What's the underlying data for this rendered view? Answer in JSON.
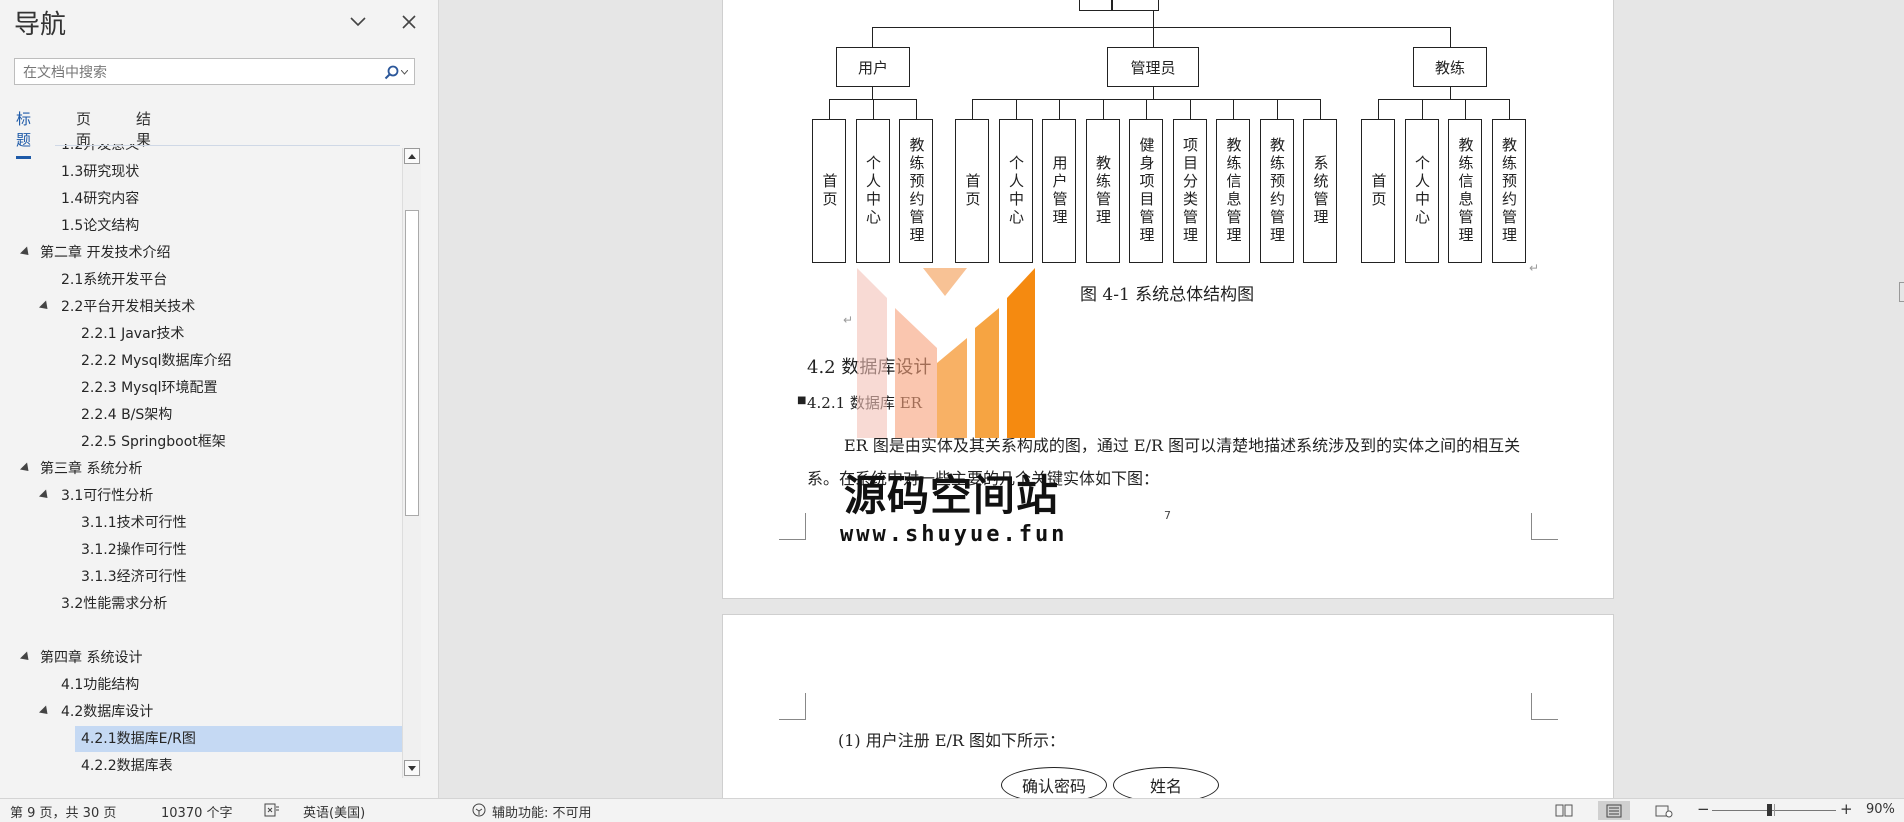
{
  "nav": {
    "title": "导航",
    "search_placeholder": "在文档中搜索",
    "tabs": [
      "标题",
      "页面",
      "结果"
    ],
    "tree": [
      {
        "label": "1.2开发意义",
        "level": 1,
        "expanded": false,
        "partial": true
      },
      {
        "label": "1.3研究现状",
        "level": 1
      },
      {
        "label": "1.4研究内容",
        "level": 1
      },
      {
        "label": "1.5论文结构",
        "level": 1
      },
      {
        "label": "第二章 开发技术介绍",
        "level": 0,
        "expanded": true
      },
      {
        "label": "2.1系统开发平台",
        "level": 1
      },
      {
        "label": "2.2平台开发相关技术",
        "level": 1,
        "expanded": true
      },
      {
        "label": "2.2.1 Javar技术",
        "level": 2
      },
      {
        "label": "2.2.2 Mysql数据库介绍",
        "level": 2
      },
      {
        "label": "2.2.3 Mysql环境配置",
        "level": 2
      },
      {
        "label": "2.2.4 B/S架构",
        "level": 2
      },
      {
        "label": "2.2.5 Springboot框架",
        "level": 2
      },
      {
        "label": "第三章 系统分析",
        "level": 0,
        "expanded": true
      },
      {
        "label": "3.1可行性分析",
        "level": 1,
        "expanded": true
      },
      {
        "label": "3.1.1技术可行性",
        "level": 2
      },
      {
        "label": "3.1.2操作可行性",
        "level": 2
      },
      {
        "label": "3.1.3经济可行性",
        "level": 2
      },
      {
        "label": "3.2性能需求分析",
        "level": 1
      },
      {
        "label": "",
        "level": 1
      },
      {
        "label": "第四章 系统设计",
        "level": 0,
        "expanded": true
      },
      {
        "label": "4.1功能结构",
        "level": 1
      },
      {
        "label": "4.2数据库设计",
        "level": 1,
        "expanded": true
      },
      {
        "label": "4.2.1数据库E/R图",
        "level": 2,
        "selected": true
      },
      {
        "label": "4.2.2数据库表",
        "level": 2
      }
    ]
  },
  "diagram": {
    "roles": [
      "用户",
      "管理员",
      "教练"
    ],
    "user_items": [
      "首页",
      "个人中心",
      "教练预约管理"
    ],
    "admin_items": [
      "首页",
      "个人中心",
      "用户管理",
      "教练管理",
      "健身项目管理",
      "项目分类管理",
      "教练信息管理",
      "教练预约管理",
      "系统管理"
    ],
    "coach_items": [
      "首页",
      "个人中心",
      "教练信息管理",
      "教练预约管理"
    ],
    "caption": "图 4-1  系统总体结构图"
  },
  "page1": {
    "heading_42": "4.2 数据库设计",
    "heading_421": "4.2.1 数据库 ER",
    "para": "ER 图是由实体及其关系构成的图，通过 E/R 图可以清楚地描述系统涉及到的实体之间的相互关系。在系统中对一些主要的几个关键实体如下图：",
    "page_number": "7"
  },
  "watermark": {
    "name": "源码空间站",
    "url": "www.shuyue.fun"
  },
  "page2": {
    "item1": "(1) 用户注册 E/R 图如下所示：",
    "ellipses": [
      "确认密码",
      "姓名"
    ]
  },
  "status": {
    "page_info": "第 9 页，共 30 页",
    "word_count": "10370 个字",
    "language": "英语(美国)",
    "accessibility": "辅助功能: 不可用",
    "zoom": "90%"
  }
}
